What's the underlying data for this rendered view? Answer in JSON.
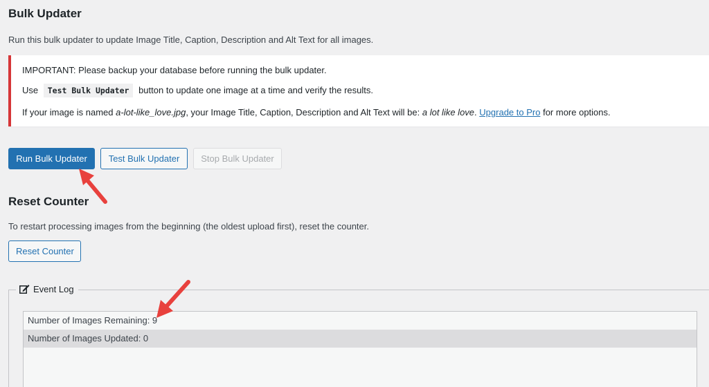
{
  "header": {
    "title": "Bulk Updater",
    "description": "Run this bulk updater to update Image Title, Caption, Description and Alt Text for all images."
  },
  "notice": {
    "line1": "IMPORTANT: Please backup your database before running the bulk updater.",
    "line2_pre": "Use",
    "line2_code": "Test Bulk Updater",
    "line2_post": "button to update one image at a time and verify the results.",
    "line3_pre": "If your image is named",
    "line3_filename": "a-lot-like_love.jpg",
    "line3_mid": ", your Image Title, Caption, Description and Alt Text will be:",
    "line3_result": "a lot like love",
    "line3_dot": ".",
    "line3_link": "Upgrade to Pro",
    "line3_post": "for more options.",
    "accent_color": "#d63638"
  },
  "actions": {
    "run_label": "Run Bulk Updater",
    "test_label": "Test Bulk Updater",
    "stop_label": "Stop Bulk Updater"
  },
  "reset": {
    "title": "Reset Counter",
    "description": "To restart processing images from the beginning (the oldest upload first), reset the counter.",
    "button_label": "Reset Counter"
  },
  "event_log": {
    "legend": "Event Log",
    "legend_icon": "edit-icon",
    "rows": [
      "Number of Images Remaining: 9",
      "Number of Images Updated: 0"
    ]
  },
  "colors": {
    "primary": "#2271b1",
    "annotation_arrow": "#e8413d"
  }
}
